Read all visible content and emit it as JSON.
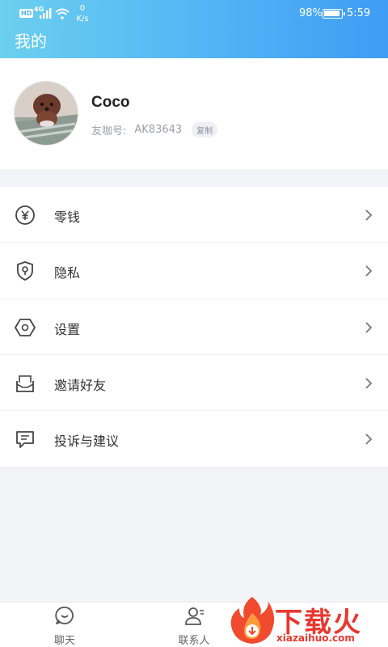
{
  "status_bar": {
    "hd": "HD",
    "network": "4G",
    "speed_value": "0",
    "speed_unit": "K/s",
    "battery_percent": "98%",
    "time": "5:59"
  },
  "header": {
    "title": "我的"
  },
  "profile": {
    "nickname": "Coco",
    "id_label": "友咖号:",
    "id_value": "AK83643",
    "copy_label": "复制"
  },
  "menu": {
    "items": [
      {
        "label": "零钱",
        "icon": "yuan-coin-icon"
      },
      {
        "label": "隐私",
        "icon": "shield-icon"
      },
      {
        "label": "设置",
        "icon": "hexagon-settings-icon"
      },
      {
        "label": "邀请好友",
        "icon": "envelope-icon"
      },
      {
        "label": "投诉与建议",
        "icon": "chat-bubble-icon"
      }
    ]
  },
  "tabbar": {
    "tabs": [
      {
        "label": "聊天",
        "icon": "chat-icon"
      },
      {
        "label": "联系人",
        "icon": "contacts-icon"
      }
    ]
  },
  "watermark": {
    "brand": "下载火",
    "url": "xiazaihuo.com"
  },
  "colors": {
    "header_start": "#6ccfee",
    "header_end": "#3f9cf4",
    "brand_red": "#e8382f"
  }
}
